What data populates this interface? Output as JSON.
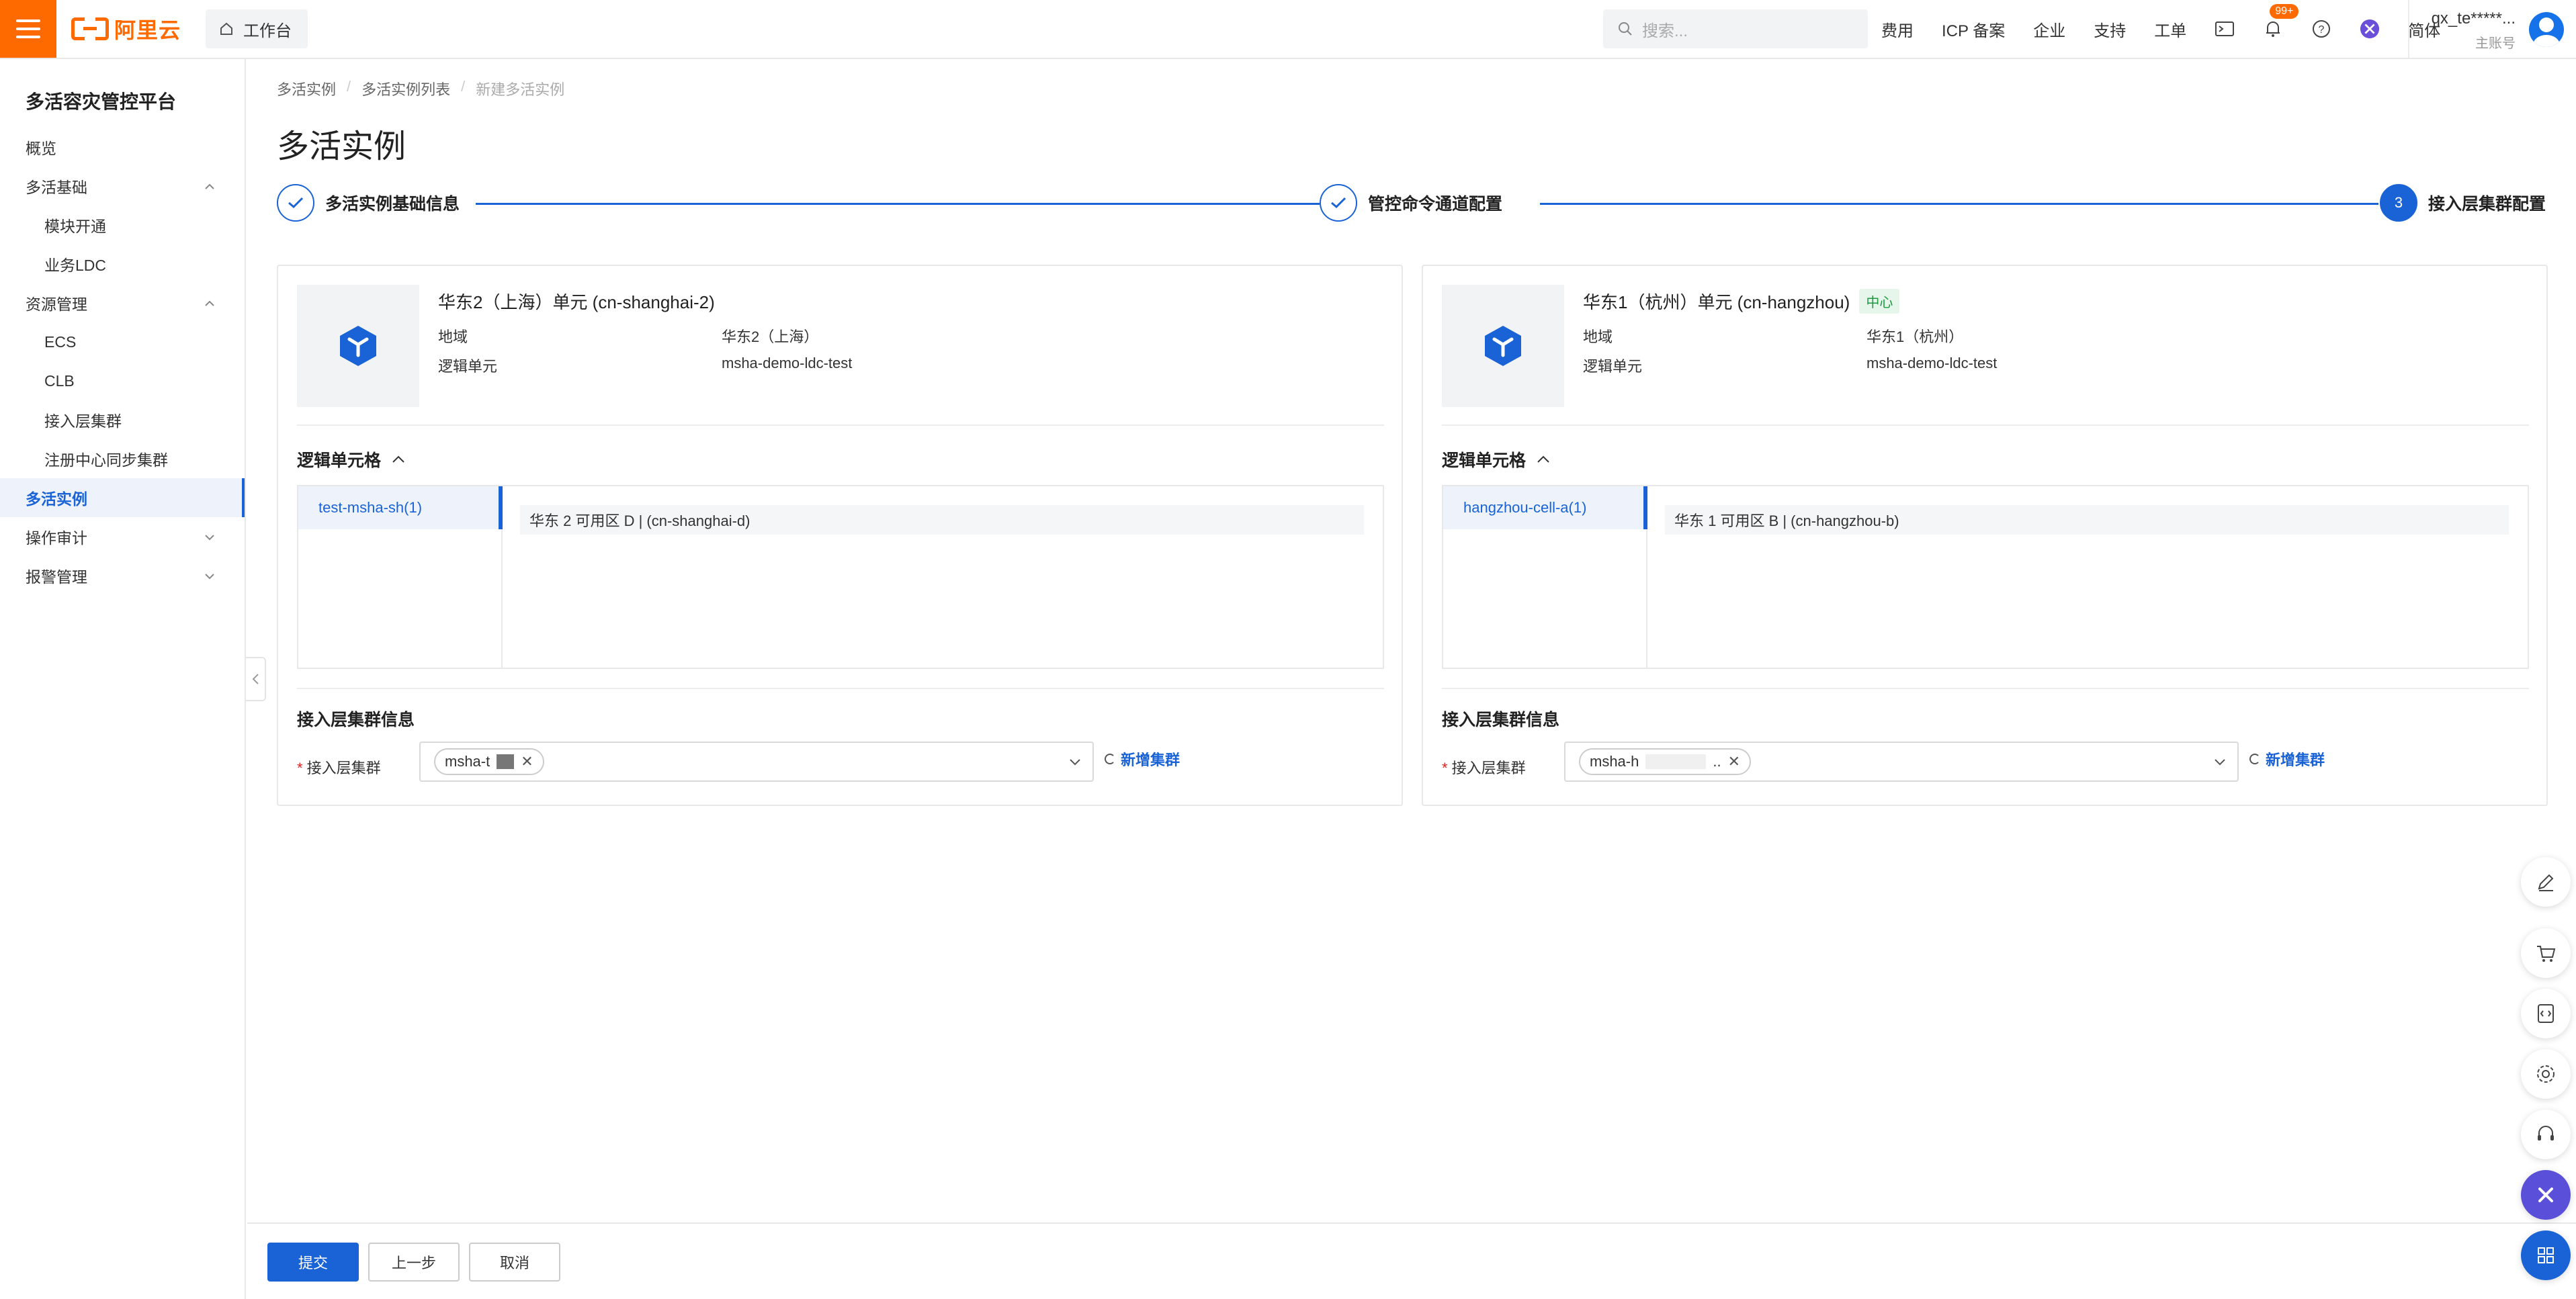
{
  "header": {
    "logo_text": "阿里云",
    "workbench": "工作台",
    "search_placeholder": "搜索...",
    "links": [
      "费用",
      "ICP 备案",
      "企业",
      "支持",
      "工单"
    ],
    "notification_badge": "99+",
    "language": "简体",
    "account_name": "qx_te*****...",
    "account_role": "主账号",
    "brand_color": "#ff6a00"
  },
  "sidebar": {
    "title": "多活容灾管控平台",
    "items": [
      {
        "label": "概览"
      },
      {
        "label": "多活基础"
      },
      {
        "label": "模块开通"
      },
      {
        "label": "业务LDC"
      },
      {
        "label": "资源管理"
      },
      {
        "label": "ECS"
      },
      {
        "label": "CLB"
      },
      {
        "label": "接入层集群"
      },
      {
        "label": "注册中心同步集群"
      },
      {
        "label": "多活实例"
      },
      {
        "label": "操作审计"
      },
      {
        "label": "报警管理"
      }
    ],
    "active": "多活实例",
    "accent_color": "#1a63d6"
  },
  "breadcrumb": [
    "多活实例",
    "多活实例列表",
    "新建多活实例"
  ],
  "page_title": "多活实例",
  "steps": [
    {
      "label": "多活实例基础信息",
      "status": "done"
    },
    {
      "label": "管控命令通道配置",
      "status": "done"
    },
    {
      "label": "接入层集群配置",
      "status": "current",
      "number": "3"
    }
  ],
  "panels": [
    {
      "region_title": "华东2（上海）单元 (cn-shanghai-2)",
      "tag": "",
      "region_label": "地域",
      "region_value": "华东2（上海）",
      "ldc_label": "逻辑单元",
      "ldc_value": "msha-demo-ldc-test",
      "cells_title": "逻辑单元格",
      "cell": "test-msha-sh(1)",
      "zone": "华东 2 可用区 D | (cn-shanghai-d)",
      "cluster_section": "接入层集群信息",
      "cluster_label": "接入层集群",
      "cluster_chip": "msha-t",
      "add_cluster": "新增集群"
    },
    {
      "region_title": "华东1（杭州）单元 (cn-hangzhou)",
      "tag": "中心",
      "region_label": "地域",
      "region_value": "华东1（杭州）",
      "ldc_label": "逻辑单元",
      "ldc_value": "msha-demo-ldc-test",
      "cells_title": "逻辑单元格",
      "cell": "hangzhou-cell-a(1)",
      "zone": "华东 1 可用区 B | (cn-hangzhou-b)",
      "cluster_section": "接入层集群信息",
      "cluster_label": "接入层集群",
      "cluster_chip": "msha-h",
      "cluster_chip_suffix": "..",
      "add_cluster": "新增集群"
    }
  ],
  "footer": {
    "submit": "提交",
    "prev": "上一步",
    "cancel": "取消"
  },
  "float_toolbar": [
    "edit-icon",
    "cart-icon",
    "code-icon",
    "settings-icon",
    "support-icon",
    "assistant-icon",
    "apps-icon"
  ]
}
